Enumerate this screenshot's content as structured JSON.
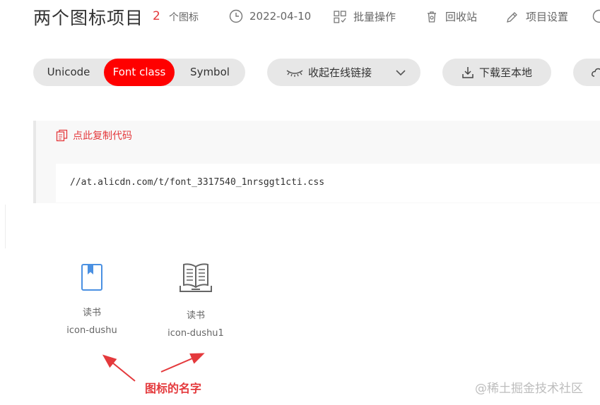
{
  "header": {
    "title": "两个图标项目",
    "icon_count": "2",
    "icon_count_label": "个图标",
    "date": "2022-04-10",
    "batch_label": "批量操作",
    "recycle_label": "回收站",
    "settings_label": "项目设置"
  },
  "tabs": [
    {
      "label": "Unicode"
    },
    {
      "label": "Font class"
    },
    {
      "label": "Symbol"
    }
  ],
  "toolbar": {
    "collapse_label": "收起在线链接",
    "download_label": "下载至本地"
  },
  "code": {
    "copy_label": "点此复制代码",
    "url": "//at.alicdn.com/t/font_3317540_1nrsggt1cti.css"
  },
  "icons": [
    {
      "name": "读书",
      "class_name": "icon-dushu",
      "icon": "bookmark-book-icon"
    },
    {
      "name": "读书",
      "class_name": "icon-dushu1",
      "icon": "open-book-icon"
    }
  ],
  "annotation": "图标的名字",
  "watermark": "@稀土掘金技术社区",
  "colors": {
    "accent": "#ff0000",
    "icon_blue": "#4a90e2",
    "icon_gray": "#666666"
  }
}
